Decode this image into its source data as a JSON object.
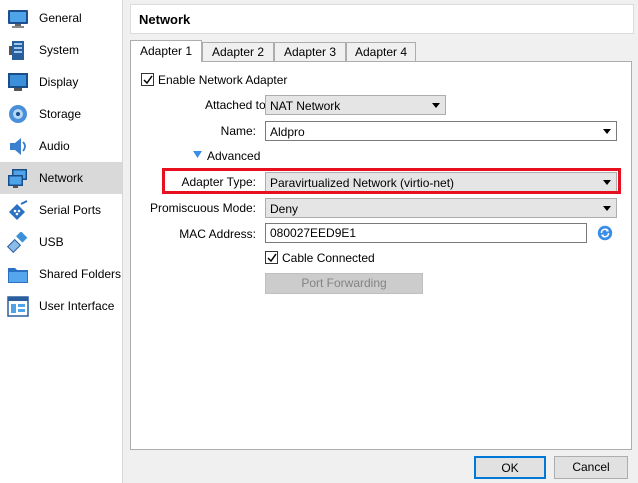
{
  "sidebar": {
    "items": [
      {
        "label": "General",
        "icon": "general-icon"
      },
      {
        "label": "System",
        "icon": "system-icon"
      },
      {
        "label": "Display",
        "icon": "display-icon"
      },
      {
        "label": "Storage",
        "icon": "storage-icon"
      },
      {
        "label": "Audio",
        "icon": "audio-icon"
      },
      {
        "label": "Network",
        "icon": "network-icon",
        "selected": true
      },
      {
        "label": "Serial Ports",
        "icon": "serial-ports-icon"
      },
      {
        "label": "USB",
        "icon": "usb-icon"
      },
      {
        "label": "Shared Folders",
        "icon": "shared-folders-icon"
      },
      {
        "label": "User Interface",
        "icon": "user-interface-icon"
      }
    ]
  },
  "header": {
    "title": "Network"
  },
  "tabs": [
    {
      "label": "Adapter 1",
      "active": true
    },
    {
      "label": "Adapter 2"
    },
    {
      "label": "Adapter 3"
    },
    {
      "label": "Adapter 4"
    }
  ],
  "adapter": {
    "enable_label": "Enable Network Adapter",
    "enabled": true,
    "attached_label": "Attached to:",
    "attached_value": "NAT Network",
    "name_label": "Name:",
    "name_value": "Aldpro",
    "advanced_label": "Advanced",
    "adapter_type_label": "Adapter Type:",
    "adapter_type_value": "Paravirtualized Network (virtio-net)",
    "promiscuous_label": "Promiscuous Mode:",
    "promiscuous_value": "Deny",
    "mac_label": "MAC Address:",
    "mac_value": "080027EED9E1",
    "cable_label": "Cable Connected",
    "cable_connected": true,
    "port_forwarding_label": "Port Forwarding"
  },
  "footer": {
    "ok_label": "OK",
    "cancel_label": "Cancel"
  },
  "colors": {
    "highlight": "#e8101e",
    "selected_item": "#d9d9d9"
  }
}
